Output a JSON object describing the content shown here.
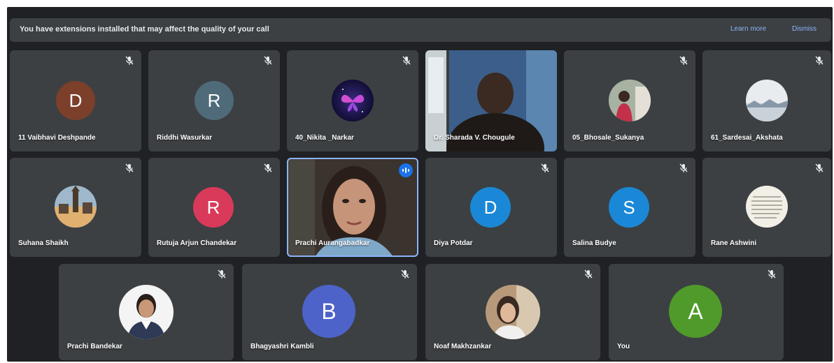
{
  "banner": {
    "message": "You have extensions installed that may affect the quality of your call",
    "learn_more": "Learn more",
    "dismiss": "Dismiss"
  },
  "participants": [
    {
      "name": "11 Vaibhavi Deshpande",
      "initial": "D",
      "color": "#7b3f2a",
      "muted": true
    },
    {
      "name": "Riddhi Wasurkar",
      "initial": "R",
      "color": "#4f6a78",
      "muted": true
    },
    {
      "name": "40_Nikita _Narkar",
      "avatar": "butterfly-photo",
      "muted": true
    },
    {
      "name": "Dr. Sharada V. Chougule",
      "video": "camera-feed",
      "muted": false
    },
    {
      "name": "05_Bhosale_Sukanya",
      "avatar": "person-photo",
      "muted": true
    },
    {
      "name": "61_Sardesai_Akshata",
      "avatar": "landscape-photo",
      "muted": true
    },
    {
      "name": "Suhana Shaikh",
      "avatar": "city-photo",
      "muted": true
    },
    {
      "name": "Rutuja Arjun Chandekar",
      "initial": "R",
      "color": "#d93a5a",
      "muted": true
    },
    {
      "name": "Prachi Aurangabadkar",
      "video": "camera-feed",
      "speaking": true,
      "muted": false
    },
    {
      "name": "Diya Potdar",
      "initial": "D",
      "color": "#1a88d6",
      "muted": true
    },
    {
      "name": "Salina Budye",
      "initial": "S",
      "color": "#1a88d6",
      "muted": true
    },
    {
      "name": "Rane Ashwini",
      "avatar": "document-photo",
      "muted": true
    },
    {
      "name": "Prachi Bandekar",
      "avatar": "portrait-photo",
      "muted": true
    },
    {
      "name": "Bhagyashri Kambli",
      "initial": "B",
      "color": "#4d63c9",
      "muted": true
    },
    {
      "name": "Noaf Makhzankar",
      "avatar": "selfie-photo",
      "muted": true
    },
    {
      "name": "You",
      "initial": "A",
      "color": "#4f9a2a",
      "muted": true
    }
  ],
  "icons": {
    "mic_off": "mic-off-icon",
    "speaking": "audio-level-icon"
  }
}
